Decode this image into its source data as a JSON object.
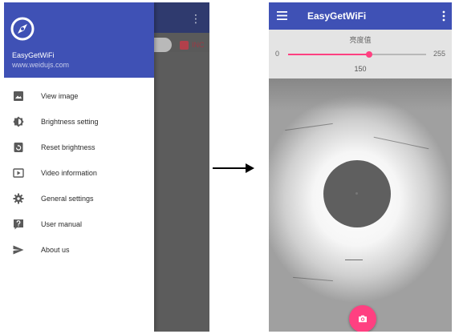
{
  "left_screen": {
    "background": {
      "overflow_icon": "⋮",
      "chip_label": "INC"
    },
    "drawer": {
      "app_name": "EasyGetWiFi",
      "website": "www.weidujs.com",
      "logo_icon": "compass-logo-icon",
      "items": [
        {
          "label": "View image",
          "icon": "image-icon"
        },
        {
          "label": "Brightness setting",
          "icon": "brightness-icon"
        },
        {
          "label": "Reset brightness",
          "icon": "reset-icon"
        },
        {
          "label": "Video information",
          "icon": "video-icon"
        },
        {
          "label": "General settings",
          "icon": "gear-icon"
        },
        {
          "label": "User manual",
          "icon": "help-icon"
        },
        {
          "label": "About us",
          "icon": "send-icon"
        }
      ]
    }
  },
  "transition_icon": "arrow-right-icon",
  "right_screen": {
    "toolbar": {
      "title": "EasyGetWiFi",
      "menu_icon": "hamburger-menu-icon",
      "overflow_icon": "kebab-more-icon"
    },
    "brightness": {
      "label": "亮度值",
      "min_label": "0",
      "max_label": "255",
      "min": 0,
      "max": 255,
      "value": 150,
      "value_label": "150"
    },
    "capture_button_icon": "camera-icon"
  },
  "colors": {
    "primary": "#3f51b5",
    "accent": "#ff4081"
  }
}
